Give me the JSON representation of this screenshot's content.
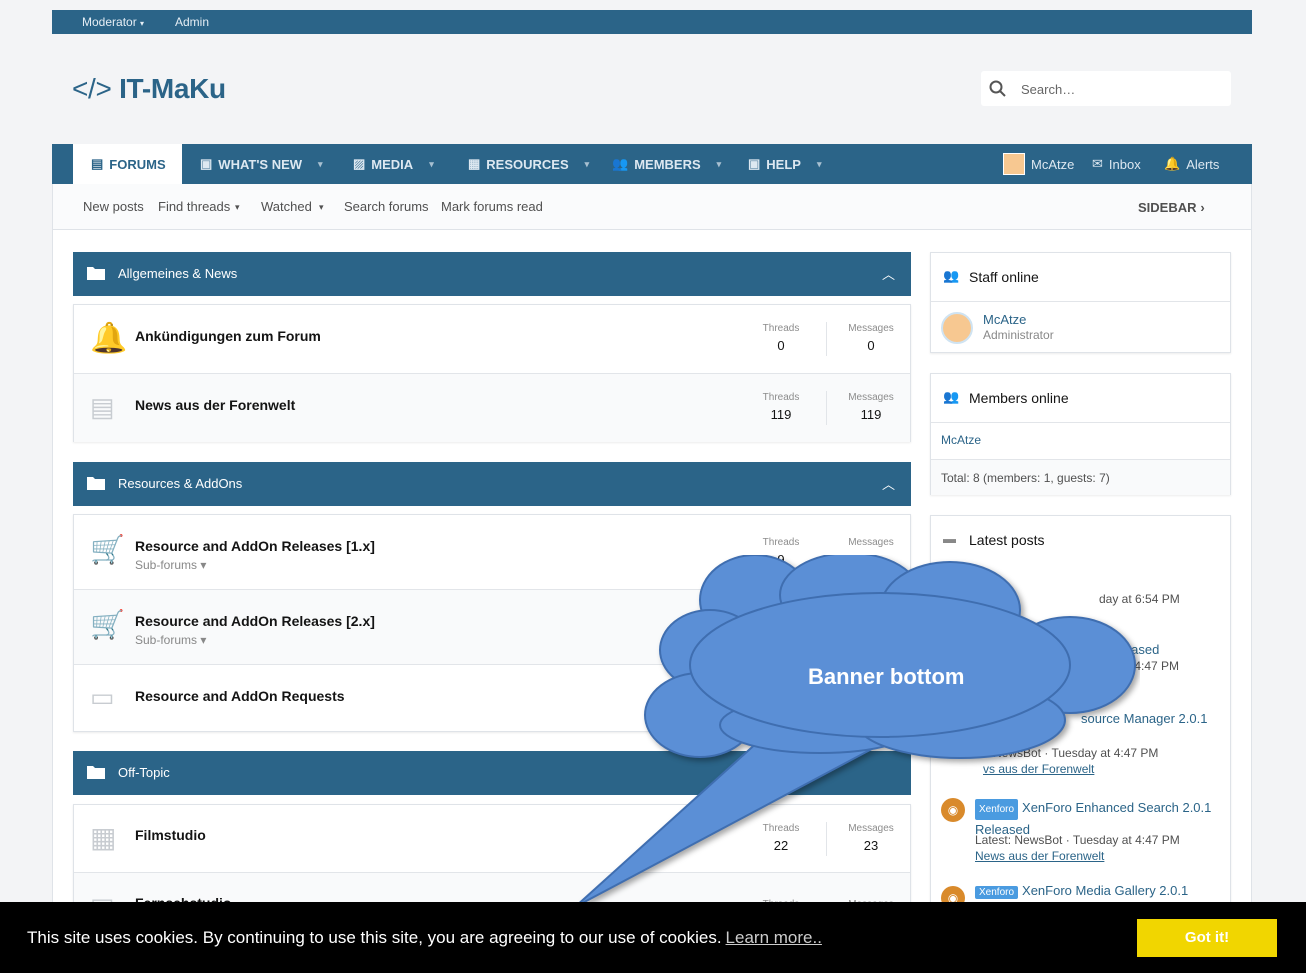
{
  "staffbar": {
    "moderator": "Moderator",
    "admin": "Admin"
  },
  "logo": {
    "text": "IT-MaKu",
    "code_glyph": "</>"
  },
  "search": {
    "placeholder": "Search…"
  },
  "nav": {
    "tabs": [
      {
        "label": "FORUMS"
      },
      {
        "label": "WHAT'S NEW"
      },
      {
        "label": "MEDIA"
      },
      {
        "label": "RESOURCES"
      },
      {
        "label": "MEMBERS"
      },
      {
        "label": "HELP"
      }
    ],
    "user": "McAtze",
    "inbox": "Inbox",
    "alerts": "Alerts"
  },
  "subnav": {
    "items": [
      "New posts",
      "Find threads",
      "Watched",
      "Search forums",
      "Mark forums read"
    ],
    "sidebar": "SIDEBAR"
  },
  "categories": [
    {
      "title": "Allgemeines & News",
      "nodes": [
        {
          "title": "Ankündigungen zum Forum",
          "threads_label": "Threads",
          "threads": "0",
          "messages_label": "Messages",
          "messages": "0",
          "icon": "bell-icon"
        },
        {
          "title": "News aus der Forenwelt",
          "threads_label": "Threads",
          "threads": "119",
          "messages_label": "Messages",
          "messages": "119",
          "icon": "newspaper-icon"
        }
      ]
    },
    {
      "title": "Resources & AddOns",
      "nodes": [
        {
          "title": "Resource and AddOn Releases [1.x]",
          "sub": "Sub-forums",
          "threads_label": "Threads",
          "threads": "9",
          "messages_label": "Messages",
          "icon": "cart-icon"
        },
        {
          "title": "Resource and AddOn Releases [2.x]",
          "sub": "Sub-forums",
          "icon": "cart-icon"
        },
        {
          "title": "Resource and AddOn Requests",
          "icon": "chat-icon"
        }
      ]
    },
    {
      "title": "Off-Topic",
      "nodes": [
        {
          "title": "Filmstudio",
          "threads_label": "Threads",
          "threads": "22",
          "messages_label": "Messages",
          "messages": "23",
          "icon": "film-icon"
        },
        {
          "title": "Fernsehstudio",
          "threads_label": "Threads",
          "messages_label": "Messages",
          "icon": "tv-icon"
        }
      ]
    }
  ],
  "sidebar": {
    "staff": {
      "title": "Staff online",
      "name": "McAtze",
      "role": "Administrator"
    },
    "members": {
      "title": "Members online",
      "name": "McAtze",
      "total": "Total: 8 (members: 1, guests: 7)"
    },
    "latest": {
      "title": "Latest posts",
      "frag1": "day at 6:54 PM",
      "frag2": "leased",
      "frag3": "at 4:47 PM",
      "frag4": "source Manager 2.0.1",
      "frag5": "t: NewsBot · Tuesday at 4:47 PM",
      "frag6": "vs aus der Forenwelt",
      "post1": {
        "badge": "Xenforo",
        "title": "XenForo Enhanced Search 2.0.1",
        "title2": "Released",
        "meta": "Latest: NewsBot · Tuesday at 4:47 PM",
        "forum": "News aus der Forenwelt"
      },
      "post2": {
        "badge": "Xenforo",
        "title": "XenForo Media Gallery 2.0.1"
      }
    }
  },
  "banner": {
    "text": "Banner bottom",
    "color": "#5b8fd6"
  },
  "cookie": {
    "text": "This site uses cookies. By continuing to use this site, you are agreeing to our use of cookies.",
    "learn": "Learn more..",
    "button": "Got it!"
  }
}
